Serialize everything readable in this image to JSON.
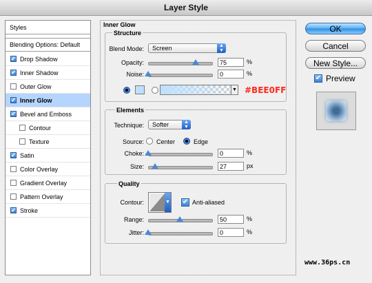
{
  "window": {
    "title": "Layer Style"
  },
  "sidebar": {
    "header": "Styles",
    "blending_options": "Blending Options: Default",
    "items": [
      {
        "label": "Drop Shadow",
        "checked": true,
        "indent": false,
        "selected": false
      },
      {
        "label": "Inner Shadow",
        "checked": true,
        "indent": false,
        "selected": false
      },
      {
        "label": "Outer Glow",
        "checked": false,
        "indent": false,
        "selected": false
      },
      {
        "label": "Inner Glow",
        "checked": true,
        "indent": false,
        "selected": true
      },
      {
        "label": "Bevel and Emboss",
        "checked": true,
        "indent": false,
        "selected": false
      },
      {
        "label": "Contour",
        "checked": false,
        "indent": true,
        "selected": false
      },
      {
        "label": "Texture",
        "checked": false,
        "indent": true,
        "selected": false
      },
      {
        "label": "Satin",
        "checked": true,
        "indent": false,
        "selected": false
      },
      {
        "label": "Color Overlay",
        "checked": false,
        "indent": false,
        "selected": false
      },
      {
        "label": "Gradient Overlay",
        "checked": false,
        "indent": false,
        "selected": false
      },
      {
        "label": "Pattern Overlay",
        "checked": false,
        "indent": false,
        "selected": false
      },
      {
        "label": "Stroke",
        "checked": true,
        "indent": false,
        "selected": false
      }
    ]
  },
  "panel": {
    "title": "Inner Glow",
    "structure": {
      "title": "Structure",
      "blend_mode_label": "Blend Mode:",
      "blend_mode_value": "Screen",
      "opacity_label": "Opacity:",
      "opacity_value": "75",
      "opacity_unit": "%",
      "opacity_level": 0.75,
      "noise_label": "Noise:",
      "noise_value": "0",
      "noise_unit": "%",
      "noise_level": 0,
      "color_hex_annotation": "#BEE0FF",
      "swatch_color": "#BEE0FF"
    },
    "elements": {
      "title": "Elements",
      "technique_label": "Technique:",
      "technique_value": "Softer",
      "source_label": "Source:",
      "source_center": "Center",
      "source_edge": "Edge",
      "choke_label": "Choke:",
      "choke_value": "0",
      "choke_unit": "%",
      "choke_level": 0,
      "size_label": "Size:",
      "size_value": "27",
      "size_unit": "px",
      "size_level": 0.11
    },
    "quality": {
      "title": "Quality",
      "contour_label": "Contour:",
      "antialiased_label": "Anti-aliased",
      "antialiased_checked": true,
      "range_label": "Range:",
      "range_value": "50",
      "range_unit": "%",
      "range_level": 0.5,
      "jitter_label": "Jitter:",
      "jitter_value": "0",
      "jitter_unit": "%",
      "jitter_level": 0
    }
  },
  "buttons": {
    "ok": "OK",
    "cancel": "Cancel",
    "new_style": "New Style...",
    "preview_label": "Preview",
    "preview_checked": true
  },
  "watermark": "www.36ps.cn",
  "colors": {
    "annotation_red": "#FF2A1A",
    "selection": "#B5D5FF",
    "accent": "#3B82D8"
  }
}
